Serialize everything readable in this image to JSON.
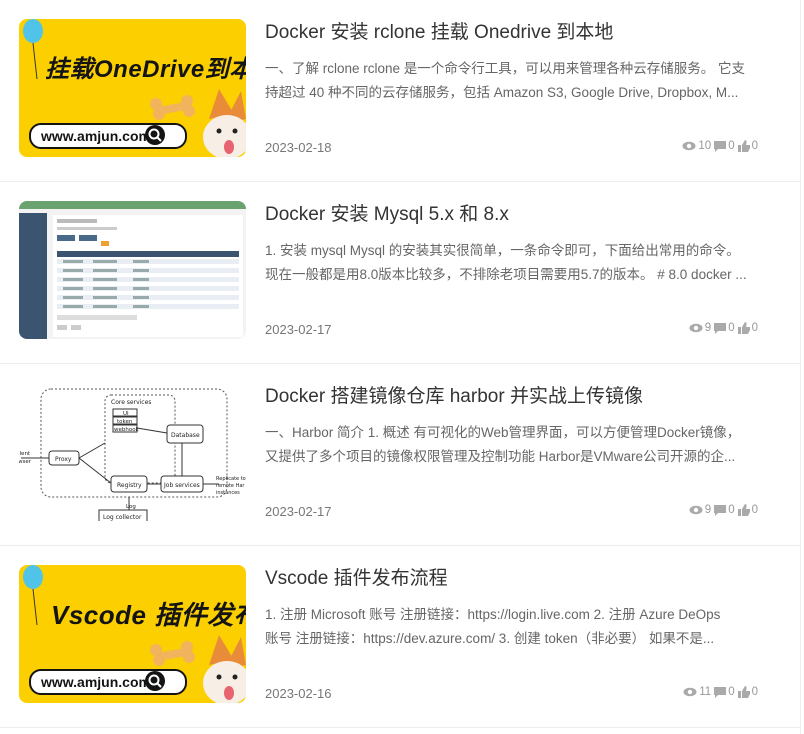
{
  "articles": [
    {
      "title": "Docker 安装 rclone 挂载 Onedrive 到本地",
      "excerpt_line1": "一、了解 rclone rclone 是一个命令行工具，可以用来管理各种云存储服务。 它支",
      "excerpt_line2": "持超过 40 种不同的云存储服务，包括 Amazon S3, Google Drive, Dropbox, M...",
      "date": "2023-02-18",
      "views": "10",
      "comments": "0",
      "likes": "0",
      "thumb_text": "挂载OneDrive到本地",
      "thumb_url": "www.amjun.com"
    },
    {
      "title": "Docker 安装 Mysql 5.x 和 8.x",
      "excerpt_line1": "1. 安装 mysql Mysql 的安装其实很简单，一条命令即可，下面给出常用的命令。",
      "excerpt_line2": "现在一般都是用8.0版本比较多，不排除老项目需要用5.7的版本。 # 8.0 docker ...",
      "date": "2023-02-17",
      "views": "9",
      "comments": "0",
      "likes": "0"
    },
    {
      "title": "Docker 搭建镜像仓库 harbor 并实战上传镜像",
      "excerpt_line1": "一、Harbor 简介 1. 概述 有可视化的Web管理界面，可以方便管理Docker镜像，",
      "excerpt_line2": "又提供了多个项目的镜像权限管理及控制功能 Harbor是VMware公司开源的企...",
      "date": "2023-02-17",
      "views": "9",
      "comments": "0",
      "likes": "0",
      "diagram": {
        "core_services": "Core services",
        "ui": "UI",
        "token": "token",
        "webhook": "webhook",
        "database": "Database",
        "proxy": "Proxy",
        "registry": "Registry",
        "job_services": "Job services",
        "log": "Log",
        "log_collector": "Log collector",
        "client_top": "llent",
        "client_bottom": "wser",
        "replicate_1": "Replicate to",
        "replicate_2": "remote Har",
        "replicate_3": "instances"
      }
    },
    {
      "title": "Vscode 插件发布流程",
      "excerpt_line1": "1. 注册 Microsoft 账号 注册链接：https://login.live.com 2. 注册 Azure DeOps",
      "excerpt_line2": "账号 注册链接：https://dev.azure.com/ 3. 创建 token（非必要） 如果不是...",
      "date": "2023-02-16",
      "views": "11",
      "comments": "0",
      "likes": "0",
      "thumb_text": "Vscode 插件发布",
      "thumb_url": "www.amjun.com"
    }
  ]
}
